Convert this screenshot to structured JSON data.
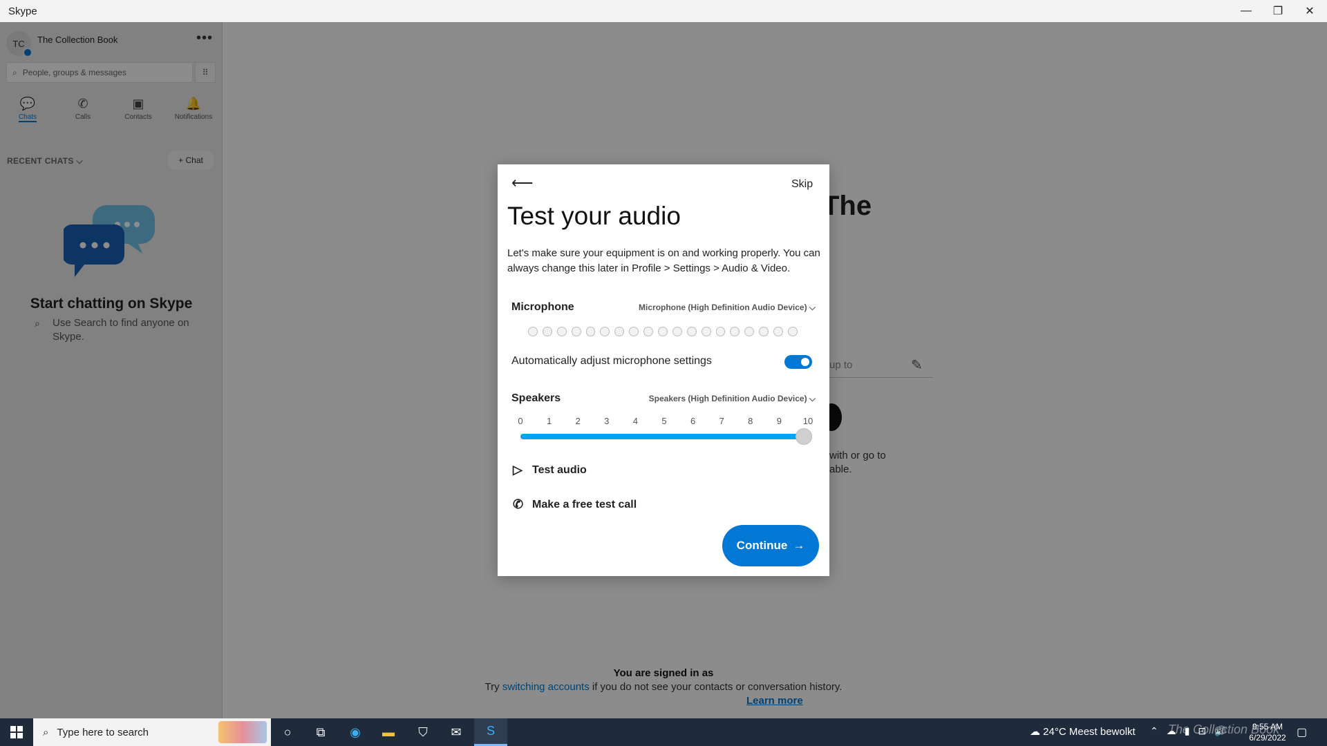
{
  "window": {
    "title": "Skype",
    "minimize_icon": "minimize-icon",
    "restore_icon": "restore-icon",
    "close_icon": "close-icon"
  },
  "sidebar": {
    "avatar_initials": "TC",
    "profile_name": "The Collection Book",
    "more_label": "•••",
    "search_placeholder": "People, groups & messages",
    "tabs": [
      {
        "label": "Chats",
        "icon": "chat-icon",
        "glyph": "💬",
        "active": true
      },
      {
        "label": "Calls",
        "icon": "phone-icon",
        "glyph": "✆",
        "active": false
      },
      {
        "label": "Contacts",
        "icon": "contacts-icon",
        "glyph": "▣",
        "active": false
      },
      {
        "label": "Notifications",
        "icon": "bell-icon",
        "glyph": "🔔",
        "active": false
      }
    ],
    "recent_chats_label": "RECENT CHATS ⌵",
    "new_chat_label": "+ Chat",
    "empty_title": "Start chatting on Skype",
    "empty_sub": "Use Search to find anyone on Skype."
  },
  "background": {
    "heading_fragment": "The",
    "mood_fragment": "up to",
    "text_fragment_1": "with or go to",
    "text_fragment_2": "able.",
    "signed_in": "You are signed in as",
    "try_prefix": "Try ",
    "try_link": "switching accounts",
    "try_suffix": " if you do not see your contacts or conversation history.",
    "learn_more": "Learn more"
  },
  "dialog": {
    "back_icon": "arrow-left-icon",
    "skip_label": "Skip",
    "title": "Test your audio",
    "description": "Let's make sure your equipment is on and working properly. You can always change this later in Profile > Settings > Audio & Video.",
    "microphone_label": "Microphone",
    "microphone_device": "Microphone (High Definition Audio Device) ⌵",
    "mic_level": 0,
    "auto_adjust_label": "Automatically adjust microphone settings",
    "auto_adjust_on": true,
    "speakers_label": "Speakers",
    "speakers_device": "Speakers (High Definition Audio Device) ⌵",
    "speaker_ticks": [
      "0",
      "1",
      "2",
      "3",
      "4",
      "5",
      "6",
      "7",
      "8",
      "9",
      "10"
    ],
    "speaker_volume": 10,
    "test_audio_label": "Test audio",
    "test_call_label": "Make a free test call",
    "continue_label": "Continue",
    "accent_color": "#0078d4"
  },
  "taskbar": {
    "search_placeholder": "Type here to search",
    "weather": "24°C  Meest bewolkt",
    "time": "9:55 AM",
    "date": "6/29/2022",
    "watermark": "The Collection Book"
  }
}
